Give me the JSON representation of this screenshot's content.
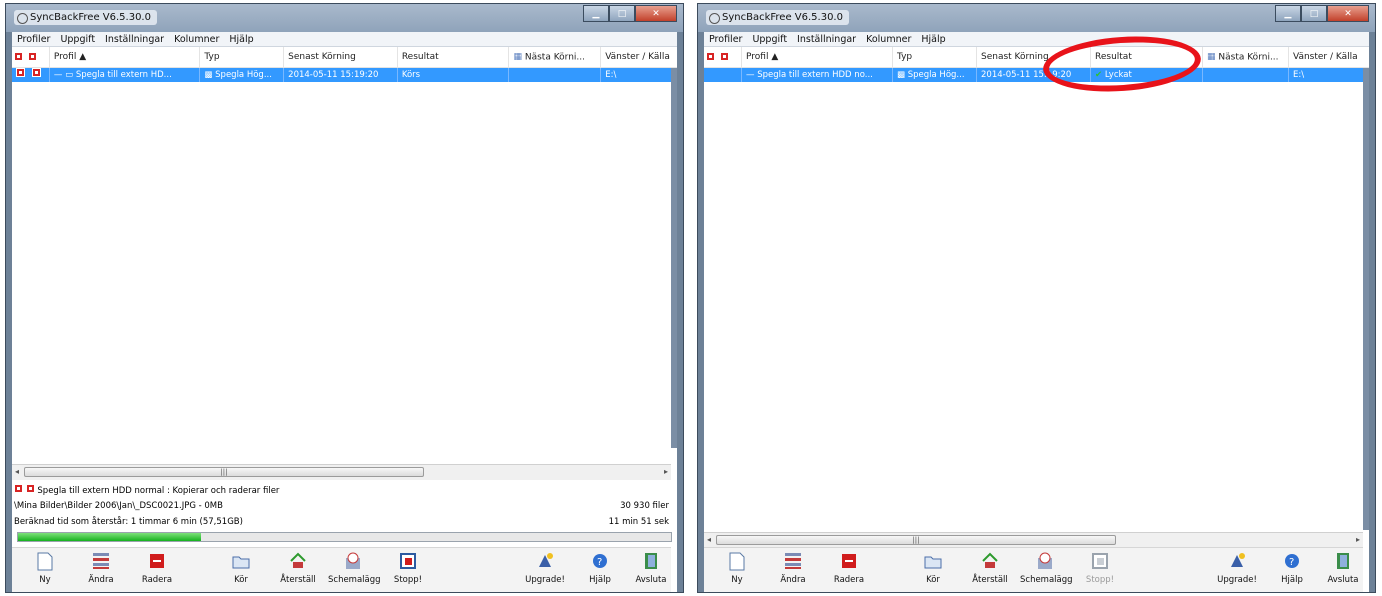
{
  "left": {
    "title": "SyncBackFree V6.5.30.0",
    "menu": [
      "Profiler",
      "Uppgift",
      "Inställningar",
      "Kolumner",
      "Hjälp"
    ],
    "columns": {
      "profil": "Profil",
      "typ": "Typ",
      "senast": "Senast Körning",
      "resultat": "Resultat",
      "nasta": "Nästa Körni...",
      "vanster": "Vänster / Källa"
    },
    "row": {
      "profil": "Spegla till extern HD...",
      "typ": "Spegla Hög...",
      "senast": "2014-05-11 15:19:20",
      "resultat": "Körs",
      "vanster": "E:\\"
    },
    "status": {
      "line1": "Spegla till extern HDD normal : Kopierar och raderar filer",
      "line2": "\\Mina Bilder\\Bilder 2006\\Jan\\_DSC0021.JPG - 0MB",
      "line2_right": "30 930 filer",
      "line3": "Beräknad tid som återstår: 1 timmar 6 min (57,51GB)",
      "line3_right": "11 min 51 sek",
      "progress": 0.28
    },
    "toolbar": [
      "Ny",
      "Ändra",
      "Radera",
      "Kör",
      "Återställ",
      "Schemalägg",
      "Stopp!",
      "Upgrade!",
      "Hjälp",
      "Avsluta"
    ]
  },
  "right": {
    "title": "SyncBackFree V6.5.30.0",
    "menu": [
      "Profiler",
      "Uppgift",
      "Inställningar",
      "Kolumner",
      "Hjälp"
    ],
    "columns": {
      "profil": "Profil",
      "typ": "Typ",
      "senast": "Senast Körning",
      "resultat": "Resultat",
      "nasta": "Nästa Körni...",
      "vanster": "Vänster / Källa"
    },
    "row": {
      "profil": "Spegla till extern HDD no...",
      "typ": "Spegla Hög...",
      "senast": "2014-05-11 15:19:20",
      "resultat": "Lyckat",
      "vanster": "E:\\"
    },
    "toolbar": [
      "Ny",
      "Ändra",
      "Radera",
      "Kör",
      "Återställ",
      "Schemalägg",
      "Stopp!",
      "Upgrade!",
      "Hjälp",
      "Avsluta"
    ]
  },
  "colors": {
    "selection": "#3399ff",
    "annotation": "#e8131a",
    "progress": "#16b21e"
  }
}
